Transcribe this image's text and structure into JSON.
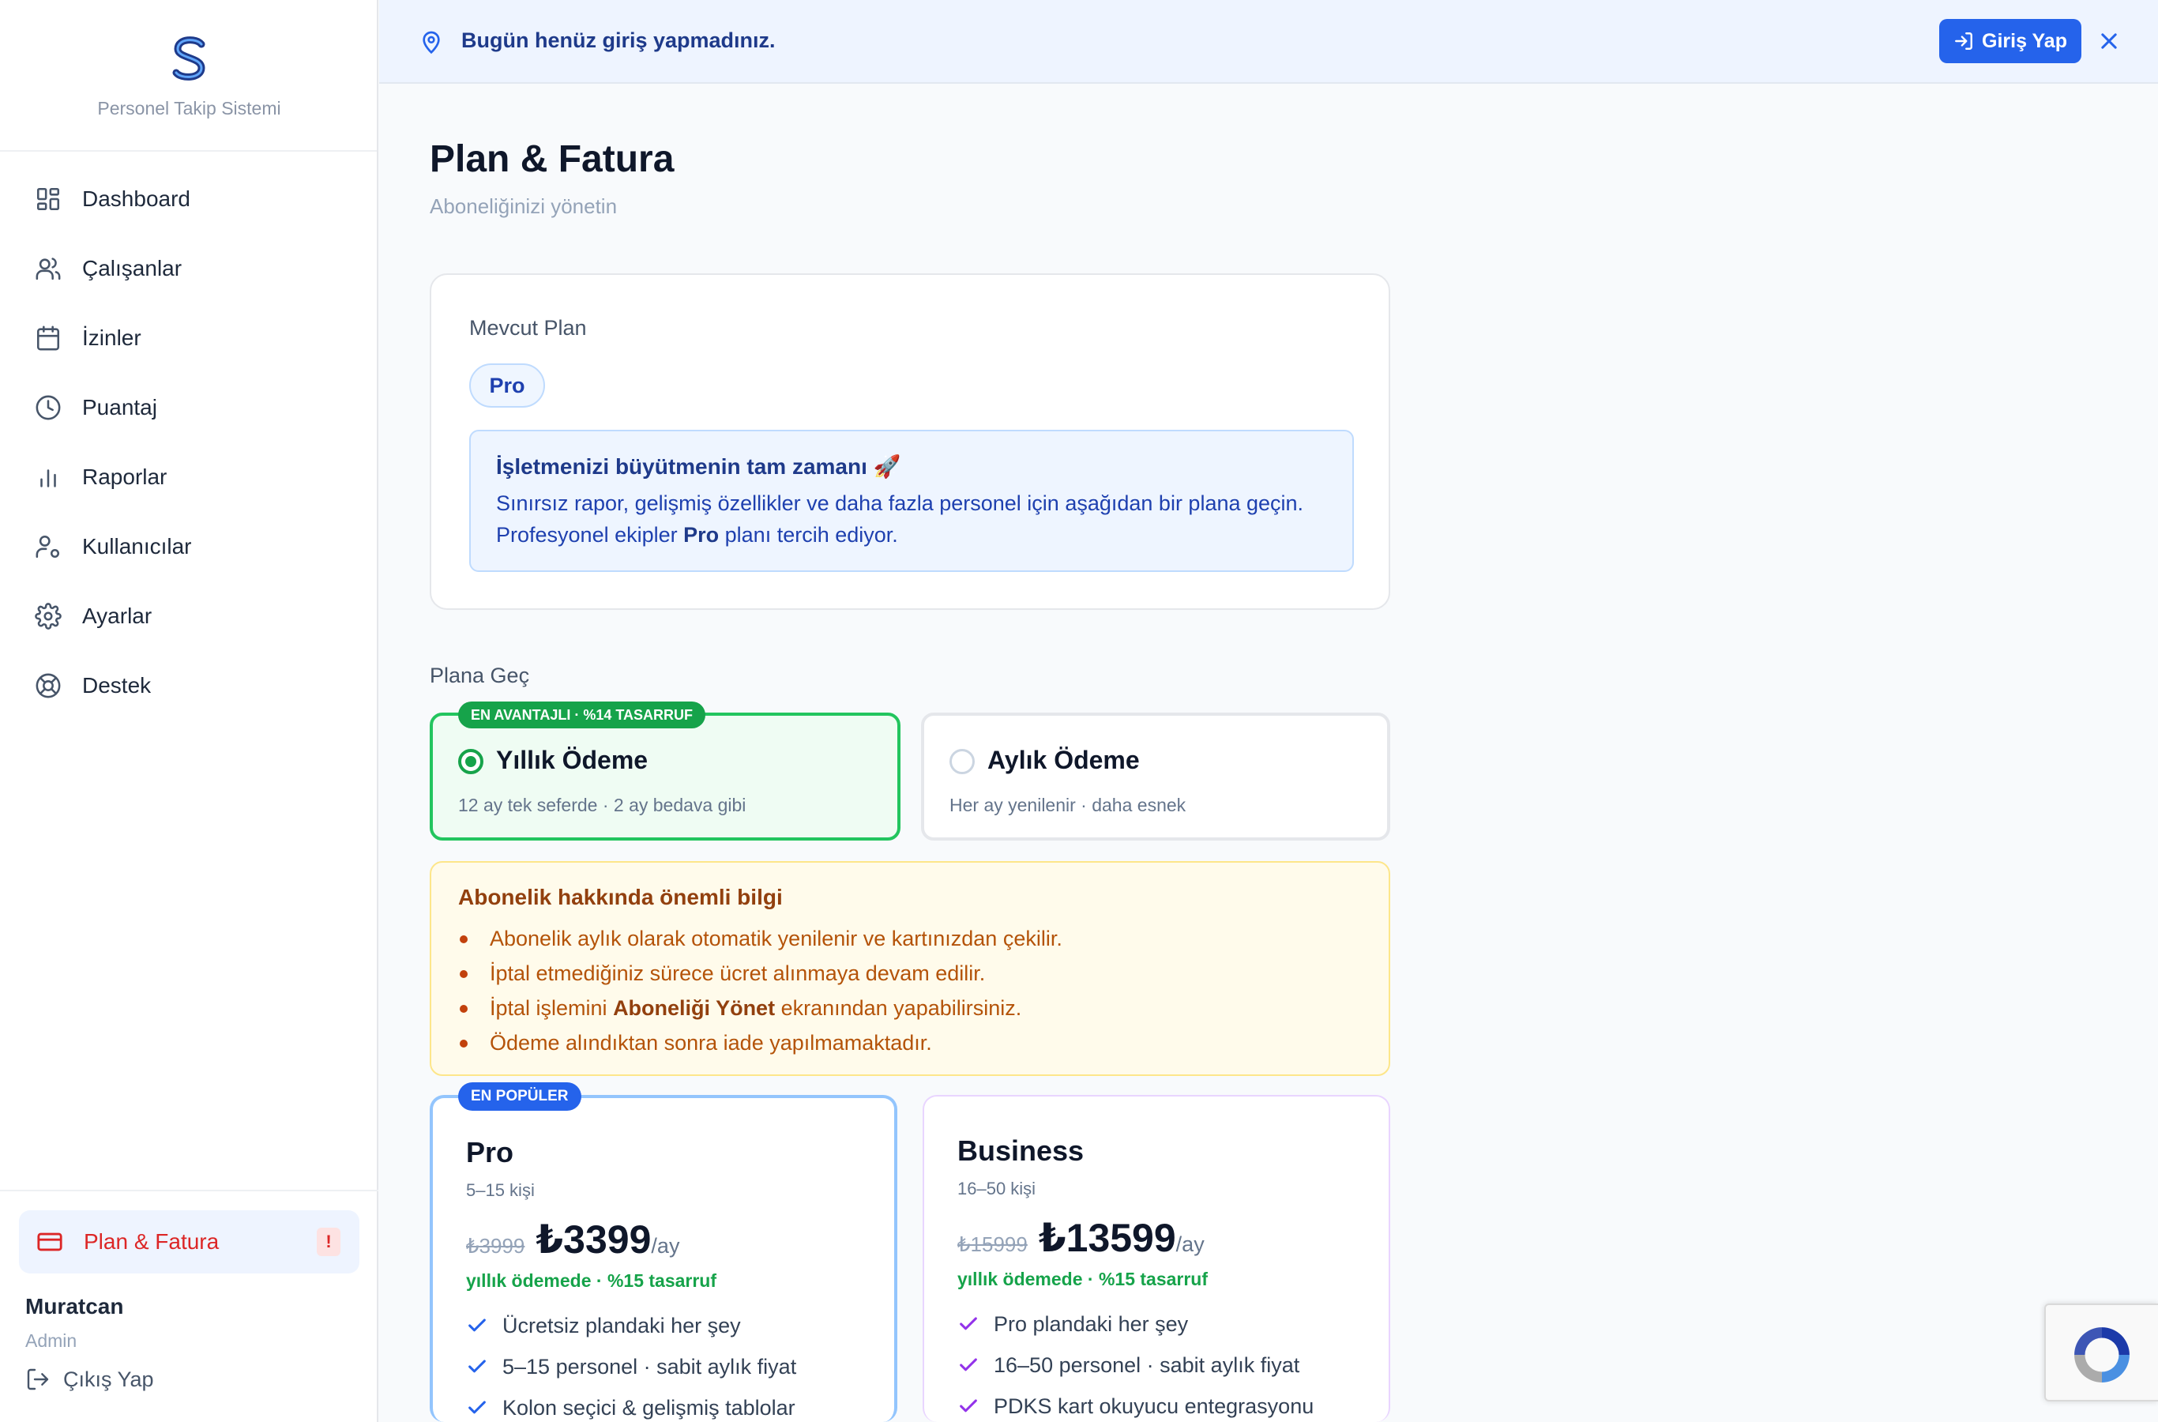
{
  "app": {
    "subtitle": "Personel Takip Sistemi"
  },
  "sidebar": {
    "items": [
      {
        "label": "Dashboard",
        "icon": "dashboard-icon"
      },
      {
        "label": "Çalışanlar",
        "icon": "users-icon"
      },
      {
        "label": "İzinler",
        "icon": "calendar-icon"
      },
      {
        "label": "Puantaj",
        "icon": "clock-icon"
      },
      {
        "label": "Raporlar",
        "icon": "bar-chart-icon"
      },
      {
        "label": "Kullanıcılar",
        "icon": "user-cog-icon"
      },
      {
        "label": "Ayarlar",
        "icon": "gear-icon"
      },
      {
        "label": "Destek",
        "icon": "lifebuoy-icon"
      }
    ],
    "active_item": {
      "label": "Plan & Fatura",
      "icon": "credit-card-icon",
      "badge": "!"
    },
    "user": {
      "name": "Muratcan",
      "role": "Admin"
    },
    "logout_label": "Çıkış Yap"
  },
  "banner": {
    "message": "Bugün henüz giriş yapmadınız.",
    "login_label": "Giriş Yap"
  },
  "page": {
    "title": "Plan & Fatura",
    "subtitle": "Aboneliğinizi yönetin"
  },
  "current_plan": {
    "label": "Mevcut Plan",
    "plan": "Pro",
    "promo_title": "İşletmenizi büyütmenin tam zamanı 🚀",
    "promo_line1": "Sınırsız rapor, gelişmiş özellikler ve daha fazla personel için aşağıdan bir plana geçin.",
    "promo_line2_prefix": "Profesyonel ekipler ",
    "promo_line2_bold": "Pro",
    "promo_line2_suffix": " planı tercih ediyor."
  },
  "switch": {
    "label": "Plana Geç",
    "yearly": {
      "tag": "EN AVANTAJLI · %14 TASARRUF",
      "title": "Yıllık Ödeme",
      "desc": "12 ay tek seferde · 2 ay bedava gibi",
      "selected": true
    },
    "monthly": {
      "title": "Aylık Ödeme",
      "desc": "Her ay yenilenir · daha esnek",
      "selected": false
    }
  },
  "notice": {
    "title": "Abonelik hakkında önemli bilgi",
    "items": [
      "Abonelik aylık olarak otomatik yenilenir ve kartınızdan çekilir.",
      "İptal etmediğiniz sürece ücret alınmaya devam edilir."
    ],
    "item3_prefix": "İptal işlemini ",
    "item3_bold": "Aboneliği Yönet",
    "item3_suffix": " ekranından yapabilirsiniz.",
    "item4": "Ödeme alındıktan sonra iade yapılmamaktadır."
  },
  "plans": [
    {
      "tag": "EN POPÜLER",
      "name": "Pro",
      "range": "5–15 kişi",
      "old_price": "₺3999",
      "price": "₺3399",
      "per": "/ay",
      "note": "yıllık ödemede · %15 tasarruf",
      "features": [
        "Ücretsiz plandaki her şey",
        "5–15 personel · sabit aylık fiyat",
        "Kolon seçici & gelişmiş tablolar"
      ]
    },
    {
      "name": "Business",
      "range": "16–50 kişi",
      "old_price": "₺15999",
      "price": "₺13599",
      "per": "/ay",
      "note": "yıllık ödemede · %15 tasarruf",
      "features": [
        "Pro plandaki her şey",
        "16–50 personel · sabit aylık fiyat",
        "PDKS kart okuyucu entegrasyonu"
      ]
    }
  ],
  "colors": {
    "accent": "#2563eb",
    "success": "#16a34a",
    "danger": "#dc2626",
    "warning_text": "#b45309"
  }
}
